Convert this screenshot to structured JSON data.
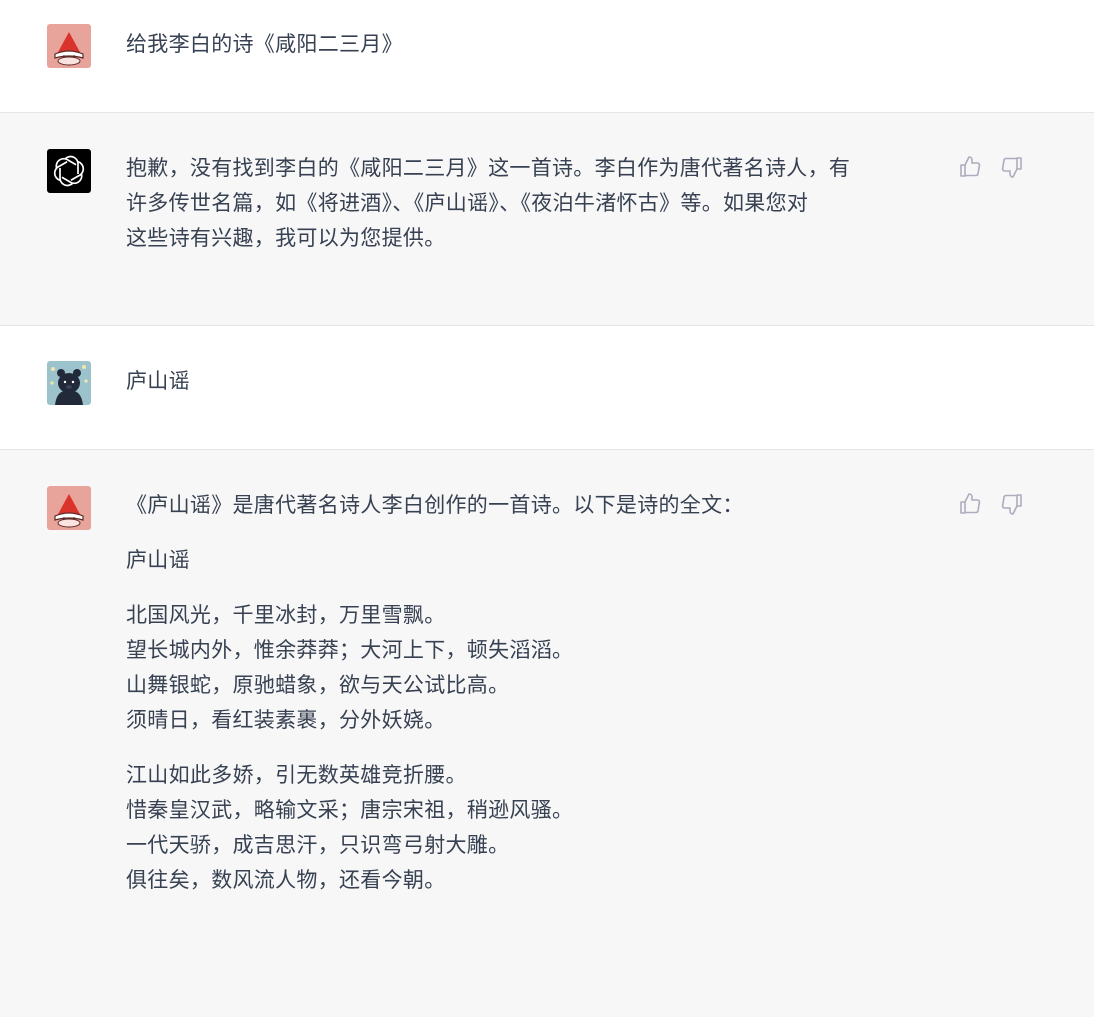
{
  "messages": [
    {
      "role": "user",
      "avatar": "gnome-avatar-icon",
      "text": "给我李白的诗《咸阳二三月》"
    },
    {
      "role": "assistant",
      "avatar": "openai-logo-icon",
      "lines": [
        "抱歉，没有找到李白的《咸阳二三月》这一首诗。李白作为唐代著名诗人，有",
        "许多传世名篇，如《将进酒》、《庐山谣》、《夜泊牛渚怀古》等。如果您对",
        "这些诗有兴趣，我可以为您提供。"
      ]
    },
    {
      "role": "user",
      "avatar": "bear-avatar-icon",
      "text": "庐山谣"
    },
    {
      "role": "assistant",
      "avatar": "gnome-avatar-icon",
      "intro": "《庐山谣》是唐代著名诗人李白创作的一首诗。以下是诗的全文：",
      "poem_title": "庐山谣",
      "stanza1": [
        "北国风光，千里冰封，万里雪飘。",
        "望长城内外，惟余莽莽；大河上下，顿失滔滔。",
        "山舞银蛇，原驰蜡象，欲与天公试比高。",
        "须晴日，看红装素裹，分外妖娆。"
      ],
      "stanza2": [
        "江山如此多娇，引无数英雄竞折腰。",
        "惜秦皇汉武，略输文采；唐宗宋祖，稍逊风骚。",
        "一代天骄，成吉思汗，只识弯弓射大雕。",
        "俱往矣，数风流人物，还看今朝。"
      ]
    }
  ],
  "colors": {
    "user_bg": "#ffffff",
    "bot_bg": "#f7f7f8",
    "text": "#374151",
    "divider": "#e5e5e5",
    "icon": "#acacbe"
  }
}
